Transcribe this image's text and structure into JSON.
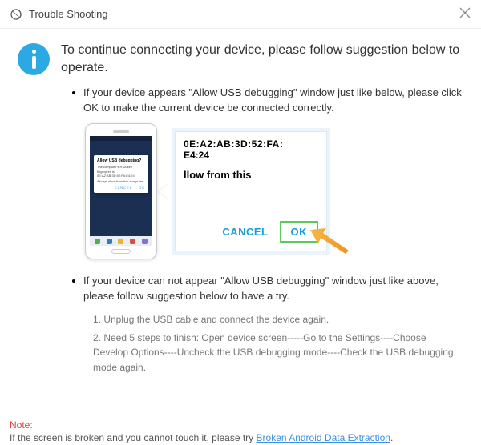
{
  "titlebar": {
    "title": "Trouble Shooting"
  },
  "heading": "To continue connecting your device, please follow suggestion below to operate.",
  "bullet1": "If your device appears \"Allow USB debugging\" window just like below, please click OK to make the current device  be connected correctly.",
  "phone_dialog": {
    "title": "Allow USB debugging?",
    "body": "The computer's RSA key fingerprint is: 0E:A2:AB:3D:52:FA:E4:24",
    "check": "Always allow from this computer",
    "cancel": "CANCEL",
    "ok": "OK"
  },
  "zoom": {
    "line1": "0E:A2:AB:3D:52:FA:",
    "line2": "E4:24",
    "line3": "llow from this",
    "cancel": "CANCEL",
    "ok": "OK"
  },
  "bullet2": "If your device can not appear \"Allow USB debugging\" window just like above, please follow suggestion below to have a try.",
  "steps": {
    "s1": "1. Unplug the USB cable and connect the device again.",
    "s2": "2. Need 5 steps to finish: Open device screen-----Go to the Settings----Choose Develop Options----Uncheck the USB debugging mode----Check the USB debugging mode again."
  },
  "footer": {
    "note_label": "Note:",
    "note_text": "If the screen is broken and you cannot touch it, please try ",
    "note_link": "Broken Android Data Extraction",
    "note_tail": "."
  }
}
